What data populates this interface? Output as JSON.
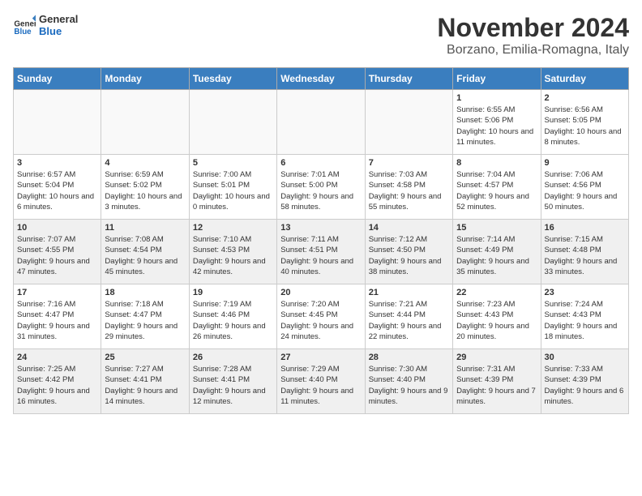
{
  "header": {
    "logo_general": "General",
    "logo_blue": "Blue",
    "month_title": "November 2024",
    "location": "Borzano, Emilia-Romagna, Italy"
  },
  "days_of_week": [
    "Sunday",
    "Monday",
    "Tuesday",
    "Wednesday",
    "Thursday",
    "Friday",
    "Saturday"
  ],
  "weeks": [
    [
      {
        "num": "",
        "info": ""
      },
      {
        "num": "",
        "info": ""
      },
      {
        "num": "",
        "info": ""
      },
      {
        "num": "",
        "info": ""
      },
      {
        "num": "",
        "info": ""
      },
      {
        "num": "1",
        "info": "Sunrise: 6:55 AM\nSunset: 5:06 PM\nDaylight: 10 hours and 11 minutes."
      },
      {
        "num": "2",
        "info": "Sunrise: 6:56 AM\nSunset: 5:05 PM\nDaylight: 10 hours and 8 minutes."
      }
    ],
    [
      {
        "num": "3",
        "info": "Sunrise: 6:57 AM\nSunset: 5:04 PM\nDaylight: 10 hours and 6 minutes."
      },
      {
        "num": "4",
        "info": "Sunrise: 6:59 AM\nSunset: 5:02 PM\nDaylight: 10 hours and 3 minutes."
      },
      {
        "num": "5",
        "info": "Sunrise: 7:00 AM\nSunset: 5:01 PM\nDaylight: 10 hours and 0 minutes."
      },
      {
        "num": "6",
        "info": "Sunrise: 7:01 AM\nSunset: 5:00 PM\nDaylight: 9 hours and 58 minutes."
      },
      {
        "num": "7",
        "info": "Sunrise: 7:03 AM\nSunset: 4:58 PM\nDaylight: 9 hours and 55 minutes."
      },
      {
        "num": "8",
        "info": "Sunrise: 7:04 AM\nSunset: 4:57 PM\nDaylight: 9 hours and 52 minutes."
      },
      {
        "num": "9",
        "info": "Sunrise: 7:06 AM\nSunset: 4:56 PM\nDaylight: 9 hours and 50 minutes."
      }
    ],
    [
      {
        "num": "10",
        "info": "Sunrise: 7:07 AM\nSunset: 4:55 PM\nDaylight: 9 hours and 47 minutes."
      },
      {
        "num": "11",
        "info": "Sunrise: 7:08 AM\nSunset: 4:54 PM\nDaylight: 9 hours and 45 minutes."
      },
      {
        "num": "12",
        "info": "Sunrise: 7:10 AM\nSunset: 4:53 PM\nDaylight: 9 hours and 42 minutes."
      },
      {
        "num": "13",
        "info": "Sunrise: 7:11 AM\nSunset: 4:51 PM\nDaylight: 9 hours and 40 minutes."
      },
      {
        "num": "14",
        "info": "Sunrise: 7:12 AM\nSunset: 4:50 PM\nDaylight: 9 hours and 38 minutes."
      },
      {
        "num": "15",
        "info": "Sunrise: 7:14 AM\nSunset: 4:49 PM\nDaylight: 9 hours and 35 minutes."
      },
      {
        "num": "16",
        "info": "Sunrise: 7:15 AM\nSunset: 4:48 PM\nDaylight: 9 hours and 33 minutes."
      }
    ],
    [
      {
        "num": "17",
        "info": "Sunrise: 7:16 AM\nSunset: 4:47 PM\nDaylight: 9 hours and 31 minutes."
      },
      {
        "num": "18",
        "info": "Sunrise: 7:18 AM\nSunset: 4:47 PM\nDaylight: 9 hours and 29 minutes."
      },
      {
        "num": "19",
        "info": "Sunrise: 7:19 AM\nSunset: 4:46 PM\nDaylight: 9 hours and 26 minutes."
      },
      {
        "num": "20",
        "info": "Sunrise: 7:20 AM\nSunset: 4:45 PM\nDaylight: 9 hours and 24 minutes."
      },
      {
        "num": "21",
        "info": "Sunrise: 7:21 AM\nSunset: 4:44 PM\nDaylight: 9 hours and 22 minutes."
      },
      {
        "num": "22",
        "info": "Sunrise: 7:23 AM\nSunset: 4:43 PM\nDaylight: 9 hours and 20 minutes."
      },
      {
        "num": "23",
        "info": "Sunrise: 7:24 AM\nSunset: 4:43 PM\nDaylight: 9 hours and 18 minutes."
      }
    ],
    [
      {
        "num": "24",
        "info": "Sunrise: 7:25 AM\nSunset: 4:42 PM\nDaylight: 9 hours and 16 minutes."
      },
      {
        "num": "25",
        "info": "Sunrise: 7:27 AM\nSunset: 4:41 PM\nDaylight: 9 hours and 14 minutes."
      },
      {
        "num": "26",
        "info": "Sunrise: 7:28 AM\nSunset: 4:41 PM\nDaylight: 9 hours and 12 minutes."
      },
      {
        "num": "27",
        "info": "Sunrise: 7:29 AM\nSunset: 4:40 PM\nDaylight: 9 hours and 11 minutes."
      },
      {
        "num": "28",
        "info": "Sunrise: 7:30 AM\nSunset: 4:40 PM\nDaylight: 9 hours and 9 minutes."
      },
      {
        "num": "29",
        "info": "Sunrise: 7:31 AM\nSunset: 4:39 PM\nDaylight: 9 hours and 7 minutes."
      },
      {
        "num": "30",
        "info": "Sunrise: 7:33 AM\nSunset: 4:39 PM\nDaylight: 9 hours and 6 minutes."
      }
    ]
  ]
}
